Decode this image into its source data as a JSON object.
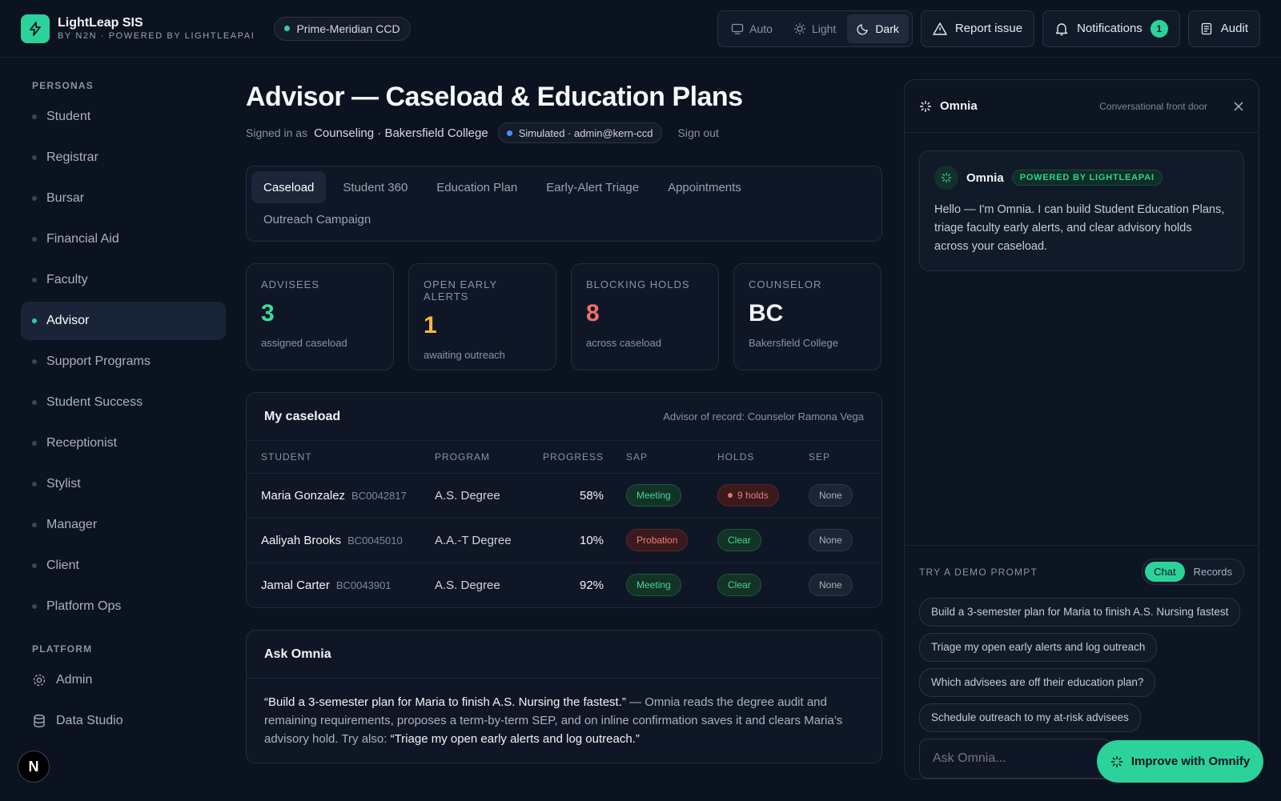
{
  "brand": {
    "name": "LightLeap SIS",
    "tagline": "BY N2N · POWERED BY LIGHTLEAPAI"
  },
  "environment": {
    "label": "Prime-Meridian CCD",
    "status_color": "#2bd39a"
  },
  "theme": {
    "options": [
      "Auto",
      "Light",
      "Dark"
    ],
    "active": "Dark"
  },
  "top_actions": {
    "report": "Report issue",
    "notifications": "Notifications",
    "notifications_count": "1",
    "audit": "Audit"
  },
  "sidebar": {
    "personas_heading": "PERSONAS",
    "personas": [
      "Student",
      "Registrar",
      "Bursar",
      "Financial Aid",
      "Faculty",
      "Advisor",
      "Support Programs",
      "Student Success",
      "Receptionist",
      "Stylist",
      "Manager",
      "Client",
      "Platform Ops"
    ],
    "active": "Advisor",
    "platform_heading": "PLATFORM",
    "platform": [
      "Admin",
      "Data Studio"
    ],
    "footer_badge": "N"
  },
  "page": {
    "title": "Advisor — Caseload & Education Plans",
    "signed_in_prefix": "Signed in as",
    "signed_in_as": "Counseling · Bakersfield College",
    "simulated": "Simulated · admin@kern-ccd",
    "sign_out": "Sign out"
  },
  "tabs": [
    "Caseload",
    "Student 360",
    "Education Plan",
    "Early-Alert Triage",
    "Appointments",
    "Outreach Campaign"
  ],
  "stats": [
    {
      "label": "ADVISEES",
      "value": "3",
      "sub": "assigned caseload",
      "color": "#3ddc97"
    },
    {
      "label": "OPEN EARLY ALERTS",
      "value": "1",
      "sub": "awaiting outreach",
      "color": "#f5b841"
    },
    {
      "label": "BLOCKING HOLDS",
      "value": "8",
      "sub": "across caseload",
      "color": "#f26d6d"
    },
    {
      "label": "COUNSELOR",
      "value": "BC",
      "sub": "Bakersfield College",
      "color": "#f2f4f7"
    }
  ],
  "caseload": {
    "title": "My caseload",
    "note": "Advisor of record: Counselor Ramona Vega",
    "columns": [
      "STUDENT",
      "PROGRAM",
      "PROGRESS",
      "SAP",
      "HOLDS",
      "SEP"
    ],
    "rows": [
      {
        "name": "Maria Gonzalez",
        "id": "BC0042817",
        "program": "A.S. Degree",
        "progress": "58%",
        "sap": "Meeting",
        "holds": "9 holds",
        "sep": "None"
      },
      {
        "name": "Aaliyah Brooks",
        "id": "BC0045010",
        "program": "A.A.-T Degree",
        "progress": "10%",
        "sap": "Probation",
        "holds": "Clear",
        "sep": "None"
      },
      {
        "name": "Jamal Carter",
        "id": "BC0043901",
        "program": "A.S. Degree",
        "progress": "92%",
        "sap": "Meeting",
        "holds": "Clear",
        "sep": "None"
      }
    ]
  },
  "ask": {
    "title": "Ask Omnia",
    "quote1": "“Build a 3-semester plan for Maria to finish A.S. Nursing the fastest.”",
    "mid": " — Omnia reads the degree audit and remaining requirements, proposes a term-by-term SEP, and on inline confirmation saves it and clears Maria’s advisory hold. Try also: ",
    "quote2": "“Triage my open early alerts and log outreach.”"
  },
  "omnia": {
    "title": "Omnia",
    "subtitle": "Conversational front door",
    "sender": "Omnia",
    "powered": "POWERED BY LIGHTLEAPAI",
    "greeting": "Hello — I'm Omnia. I can build Student Education Plans, triage faculty early alerts, and clear advisory holds across your caseload.",
    "demo_heading": "TRY A DEMO PROMPT",
    "modes": [
      "Chat",
      "Records"
    ],
    "active_mode": "Chat",
    "prompts": [
      "Build a 3-semester plan for Maria to finish A.S. Nursing fastest",
      "Triage my open early alerts and log outreach",
      "Which advisees are off their education plan?",
      "Schedule outreach to my at-risk advisees"
    ],
    "input_placeholder": "Ask Omnia..."
  },
  "improve_button": "Improve with Omnify"
}
